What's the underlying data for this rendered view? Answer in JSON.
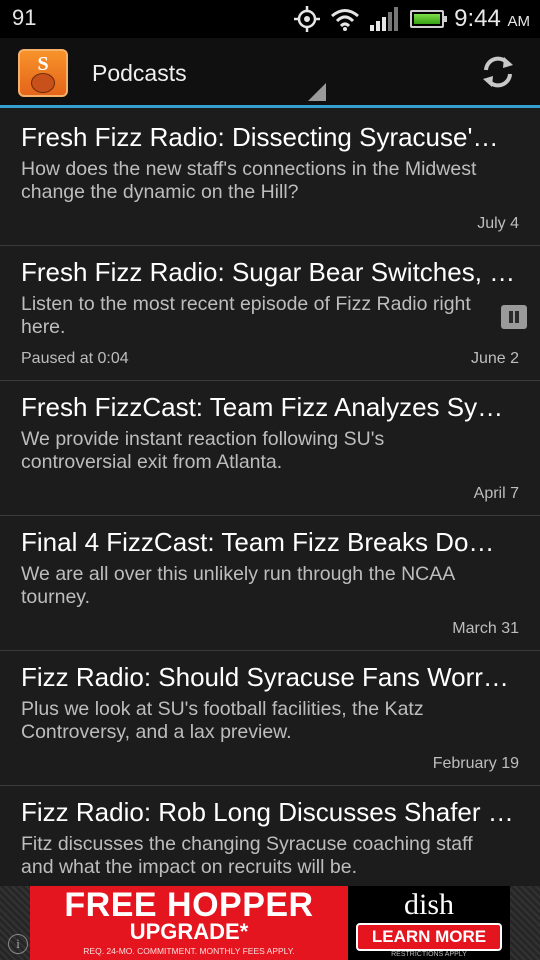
{
  "status_bar": {
    "notification_count": "91",
    "time": "9:44",
    "ampm": "AM",
    "icons": [
      "gps-icon",
      "wifi-icon",
      "signal-icon",
      "battery-icon"
    ]
  },
  "action_bar": {
    "title": "Podcasts",
    "logo_letter": "S",
    "accent_color": "#35a0d0"
  },
  "podcasts": [
    {
      "title": "Fresh Fizz Radio: Dissecting Syracuse'…",
      "description": "How does the new staff's connections in the Midwest change the dynamic on the Hill?",
      "date": "July 4"
    },
    {
      "title": "Fresh Fizz Radio: Sugar Bear Switches, …",
      "description": "Listen to the most recent episode of Fizz Radio right here.",
      "date": "June 2",
      "status": "Paused at 0:04"
    },
    {
      "title": "Fresh FizzCast: Team Fizz Analyzes Sy…",
      "description": "We provide instant reaction following SU's controversial exit from Atlanta.",
      "date": "April 7"
    },
    {
      "title": "Final 4 FizzCast: Team Fizz Breaks Do…",
      "description": "We are all over this unlikely run through the NCAA tourney.",
      "date": "March 31"
    },
    {
      "title": "Fizz Radio: Should Syracuse Fans Worr…",
      "description": "Plus we look at SU's football facilities, the Katz Controversy, and a lax preview.",
      "date": "February 19"
    },
    {
      "title": "Fizz Radio: Rob Long Discusses Shafer …",
      "description": "Fitz discusses the changing Syracuse coaching staff and what the impact on recruits will be.",
      "date": ""
    }
  ],
  "ad": {
    "headline": "FREE HOPPER",
    "subline": "UPGRADE*",
    "fine_print": "REQ. 24-MO. COMMITMENT. MONTHLY FEES APPLY.",
    "brand": "dish",
    "cta": "LEARN MORE",
    "restrictions": "RESTRICTIONS APPLY",
    "info": "i"
  }
}
